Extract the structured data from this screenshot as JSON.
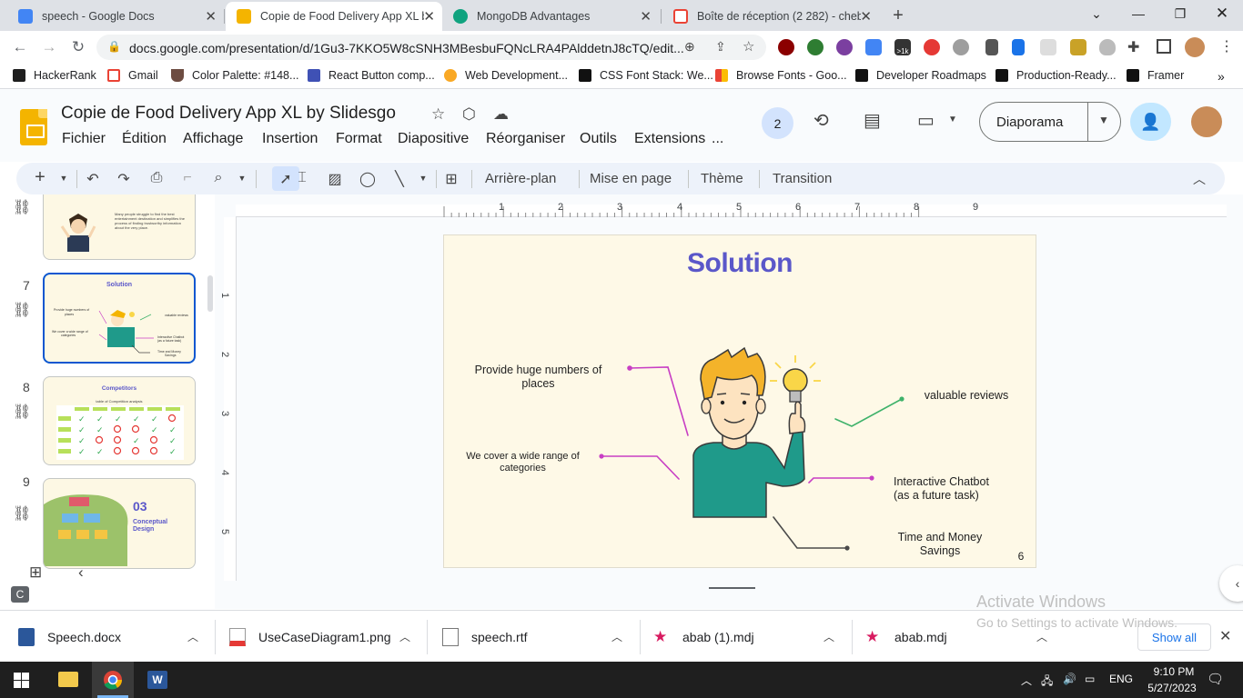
{
  "browser": {
    "tabs": [
      {
        "title": "speech - Google Docs",
        "color": "#4285f4"
      },
      {
        "title": "Copie de Food Delivery App XL b",
        "color": "#f4b400"
      },
      {
        "title": "MongoDB Advantages",
        "color": "#10a37f"
      },
      {
        "title": "Boîte de réception (2 282) - cheb",
        "color": "#ea4335"
      }
    ],
    "url": "docs.google.com/presentation/d/1Gu3-7KKO5W8cSNH3MBesbuFQNcLRA4PAlddetnJ8cTQ/edit...",
    "ext_badge": ">1k",
    "bookmarks": [
      "HackerRank",
      "Gmail",
      "Color Palette: #148...",
      "React Button comp...",
      "Web Development...",
      "CSS Font Stack: We...",
      "Browse Fonts - Goo...",
      "Developer Roadmaps",
      "Production-Ready...",
      "Framer"
    ]
  },
  "docs": {
    "title": "Copie de Food Delivery App XL by Slidesgo",
    "menus": [
      "Fichier",
      "Édition",
      "Affichage",
      "Insertion",
      "Format",
      "Diapositive",
      "Réorganiser",
      "Outils",
      "Extensions",
      "..."
    ],
    "collaborators": "2",
    "slideshow_label": "Diaporama",
    "toolbar": {
      "background": "Arrière-plan",
      "layout": "Mise en page",
      "theme": "Thème",
      "transition": "Transition"
    }
  },
  "filmstrip": {
    "slide6_text": "Many people struggle to find the best entertainment destination and simplifies the process of finding trustworthy information about the very place.",
    "slide7": {
      "number": "7",
      "title": "Solution"
    },
    "slide8": {
      "number": "8",
      "title": "Competitors",
      "subtitle": "table of Competition analysis"
    },
    "slide9": {
      "number": "9",
      "num_text": "03",
      "title": "Conceptual Design"
    }
  },
  "ruler": {
    "h": [
      "1",
      "2",
      "3",
      "4",
      "5",
      "6",
      "7",
      "8",
      "9"
    ],
    "v": [
      "1",
      "2",
      "3",
      "4",
      "5"
    ]
  },
  "slide": {
    "title": "Solution",
    "labels": {
      "places": "Provide huge numbers of places",
      "categories": "We cover a wide range of categories",
      "reviews": "valuable reviews",
      "chatbot_1": "Interactive Chatbot",
      "chatbot_2": "(as a future task)",
      "time_money": "Time and Money Savings"
    },
    "page_number": "6",
    "colors": {
      "title": "#5a57c9",
      "background": "#fef9e7",
      "magenta": "#c83fc4",
      "green": "#3eb26a",
      "dark": "#4a4a4a"
    }
  },
  "watermark": {
    "line1": "Activate Windows",
    "line2": "Go to Settings to activate Windows."
  },
  "downloads": {
    "items": [
      "Speech.docx",
      "UseCaseDiagram1.png",
      "speech.rtf",
      "abab (1).mdj",
      "abab.mdj"
    ],
    "show_all": "Show all"
  },
  "taskbar": {
    "lang": "ENG",
    "time": "9:10 PM",
    "date": "5/27/2023"
  }
}
